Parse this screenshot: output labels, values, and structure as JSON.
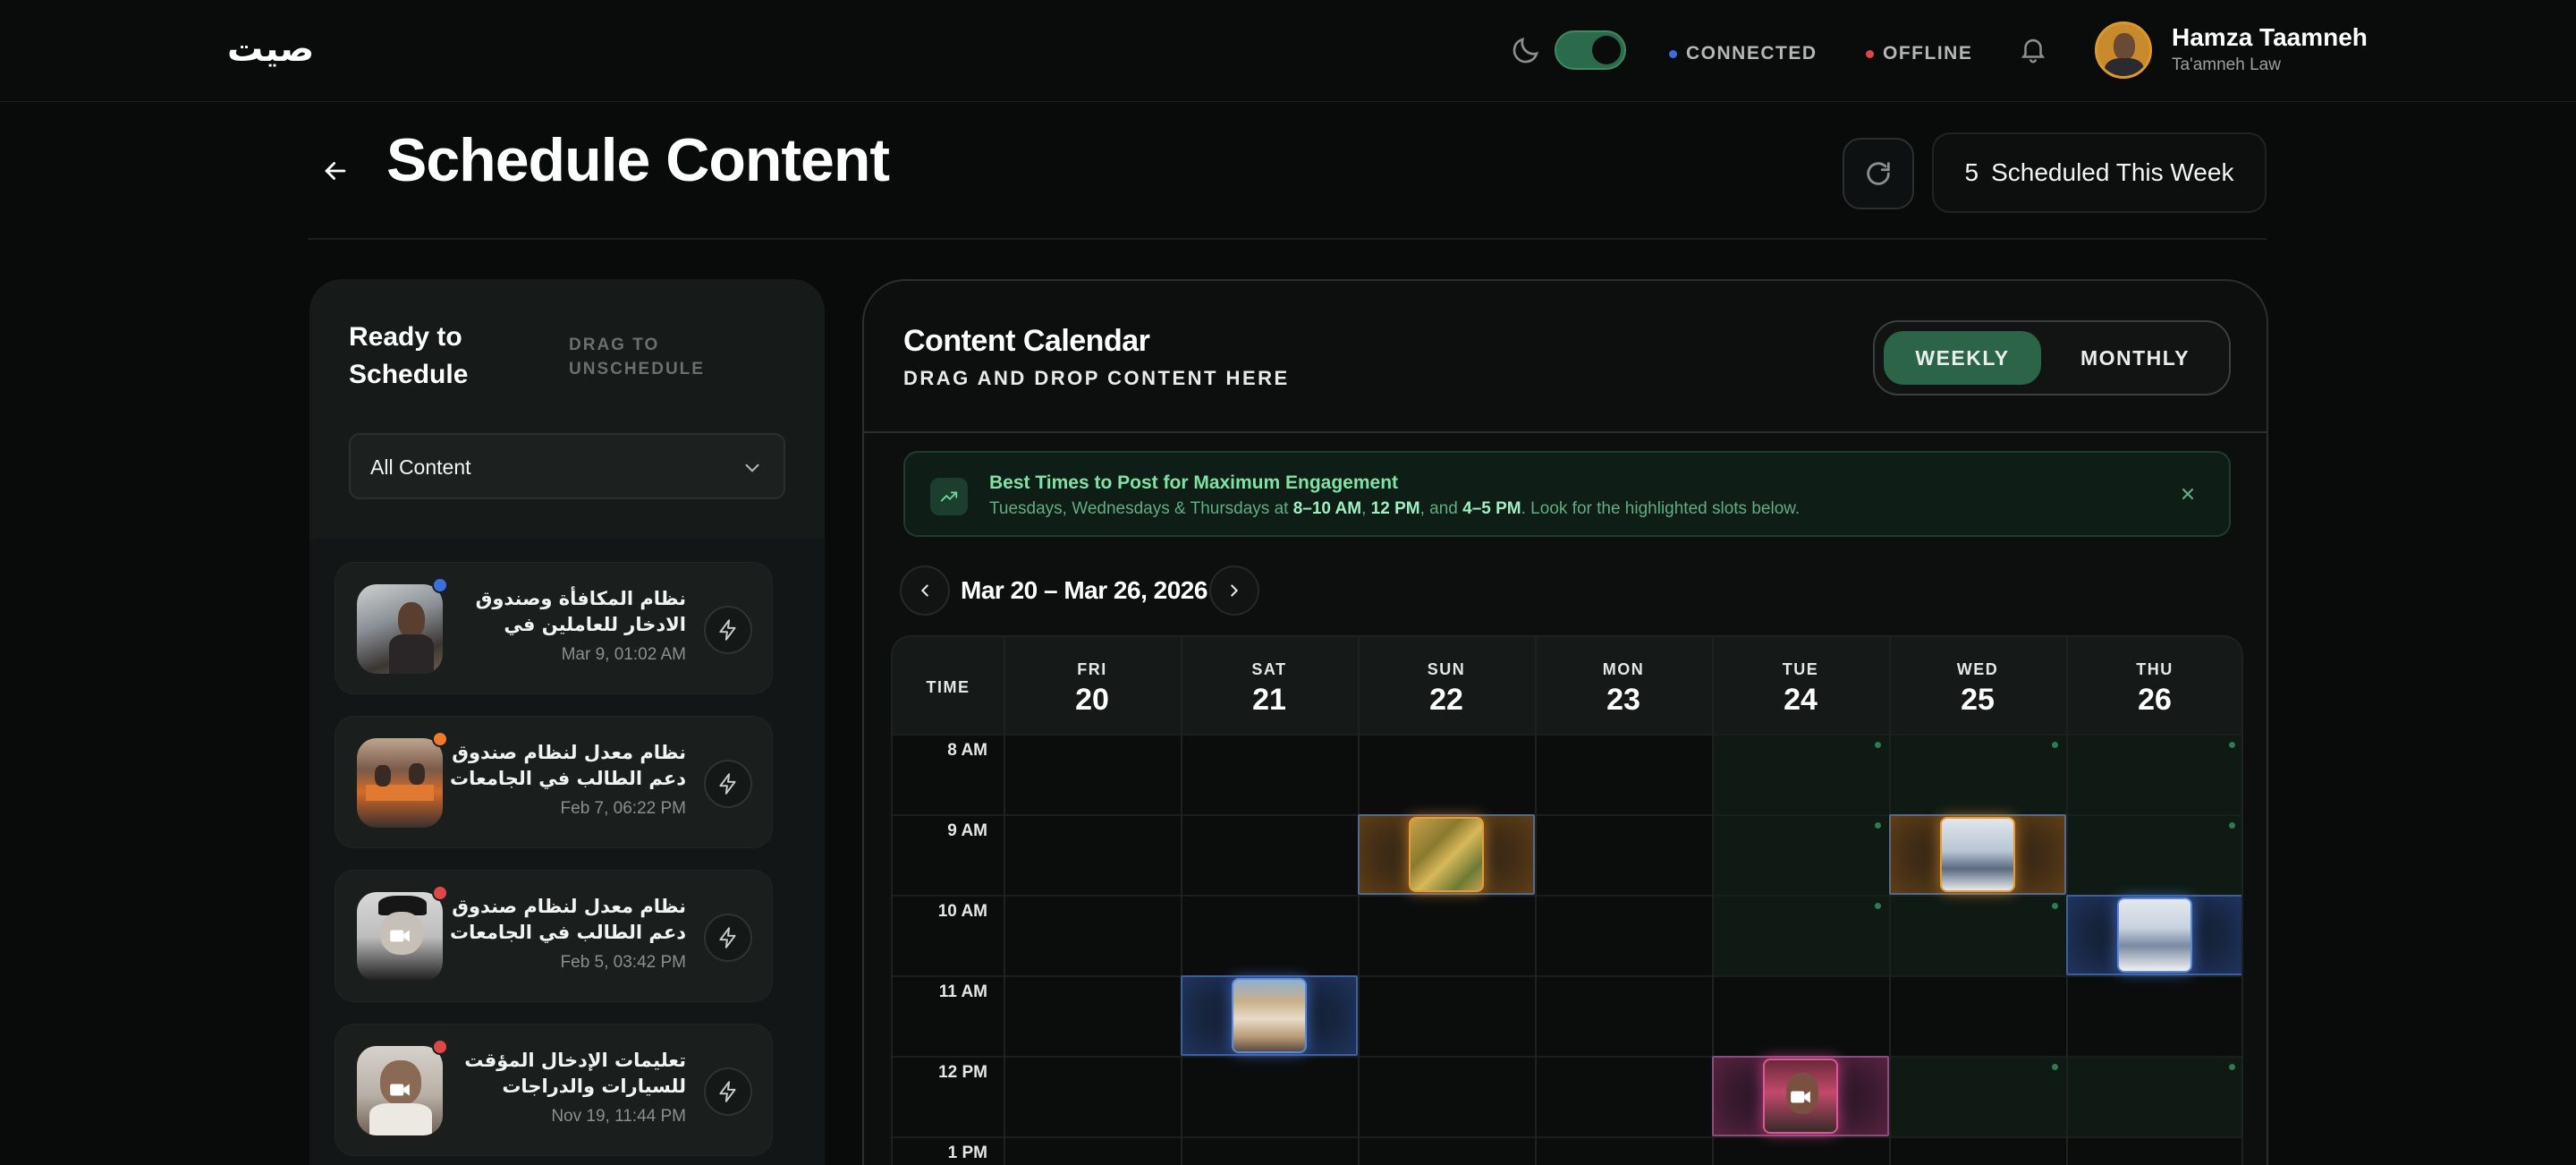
{
  "nav": {
    "logo": "صيت",
    "connected_label": "CONNECTED",
    "offline_label": "OFFLINE",
    "connected_color": "#3b6fe0",
    "offline_color": "#e04848",
    "dark_mode_on": true,
    "icons": [
      "moon-icon",
      "bell-icon"
    ],
    "user": {
      "name": "Hamza Taamneh",
      "org": "Ta'amneh Law"
    }
  },
  "header": {
    "title": "Schedule Content",
    "scheduled_count": "5",
    "scheduled_label": "Scheduled This Week"
  },
  "sidebar": {
    "title": "Ready to Schedule",
    "hint": "DRAG TO UNSCHEDULE",
    "filter": "All Content",
    "items": [
      {
        "title": "نظام المكافأة وصندوق الادخار للعاملين في جامعة الحسين بن...",
        "date": "Mar 9, 01:02 AM",
        "status_color": "#3b6fe0",
        "media": "image"
      },
      {
        "title": "نظام معدل لنظام صندوق دعم الطالب في الجامعات الرسمية ...",
        "date": "Feb 7, 06:22 PM",
        "status_color": "#f07a2a",
        "media": "image"
      },
      {
        "title": "نظام معدل لنظام صندوق دعم الطالب في الجامعات الرسمية ...",
        "date": "Feb 5, 03:42 PM",
        "status_color": "#e04848",
        "media": "video"
      },
      {
        "title": "تعليمات الإدخال المؤقت للسيارات والدراجات الخاصة...",
        "date": "Nov 19, 11:44 PM",
        "status_color": "#e04848",
        "media": "video"
      }
    ]
  },
  "calendar": {
    "title": "Content Calendar",
    "subtitle": "DRAG AND DROP CONTENT HERE",
    "views": {
      "weekly": "WEEKLY",
      "monthly": "MONTHLY",
      "active": "weekly"
    },
    "best_times": {
      "title": "Best Times to Post for Maximum Engagement",
      "text_prefix": "Tuesdays, Wednesdays & Thursdays at ",
      "t1": "8–10 AM",
      "sep1": ", ",
      "t2": "12 PM",
      "sep2": ", and ",
      "t3": "4–5 PM",
      "text_suffix": ". Look for the highlighted slots below."
    },
    "range": "Mar 20 – Mar 26, 2026",
    "time_header": "TIME",
    "days": [
      {
        "dow": "FRI",
        "num": "20"
      },
      {
        "dow": "SAT",
        "num": "21"
      },
      {
        "dow": "SUN",
        "num": "22"
      },
      {
        "dow": "MON",
        "num": "23"
      },
      {
        "dow": "TUE",
        "num": "24"
      },
      {
        "dow": "WED",
        "num": "25"
      },
      {
        "dow": "THU",
        "num": "26"
      }
    ],
    "hours": [
      "8 AM",
      "9 AM",
      "10 AM",
      "11 AM",
      "12 PM",
      "1 PM"
    ],
    "best_slots": [
      {
        "day": 4,
        "hours": [
          0,
          1,
          2,
          4
        ]
      },
      {
        "day": 5,
        "hours": [
          0,
          1,
          2,
          4
        ]
      },
      {
        "day": 6,
        "hours": [
          0,
          1,
          2,
          4
        ]
      }
    ],
    "events": [
      {
        "day": 2,
        "hour": 1,
        "platform": "orange",
        "media": "image"
      },
      {
        "day": 5,
        "hour": 1,
        "platform": "orange",
        "media": "image"
      },
      {
        "day": 6,
        "hour": 2,
        "platform": "blue",
        "media": "image"
      },
      {
        "day": 1,
        "hour": 3,
        "platform": "blue",
        "media": "image"
      },
      {
        "day": 4,
        "hour": 4,
        "platform": "pink",
        "media": "video"
      }
    ]
  }
}
